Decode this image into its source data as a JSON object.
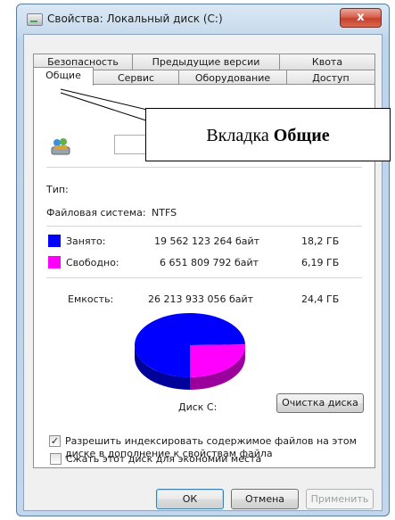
{
  "window": {
    "title": "Свойства: Локальный диск (C:)",
    "close_label": "x"
  },
  "tabs": {
    "row1": [
      "Безопасность",
      "Предыдущие версии",
      "Квота"
    ],
    "row2": [
      "Общие",
      "Сервис",
      "Оборудование",
      "Доступ"
    ],
    "active": "Общие"
  },
  "general": {
    "type_label": "Тип:",
    "fs_label": "Файловая система:",
    "fs_value": "NTFS",
    "used": {
      "label": "Занято:",
      "bytes": "19 562 123 264 байт",
      "size": "18,2 ГБ",
      "color": "#0000ff"
    },
    "free": {
      "label": "Свободно:",
      "bytes": "6 651 809 792 байт",
      "size": "6,19 ГБ",
      "color": "#ff00ff"
    },
    "capacity": {
      "label": "Емкость:",
      "bytes": "26 213 933 056 байт",
      "size": "24,4 ГБ"
    },
    "chart_caption": "Диск C:",
    "cleanup_button": "Очистка диска",
    "compress_label": "Сжать этот диск для экономии места",
    "compress_checked": false,
    "index_label_line1": "Разрешить индексировать содержимое файлов на этом",
    "index_label_line2": "диске в дополнение к свойствам файла",
    "index_checked": true
  },
  "buttons": {
    "ok": "ОК",
    "cancel": "Отмена",
    "apply": "Применить"
  },
  "callout": {
    "prefix": "Вкладка ",
    "bold": "Общие"
  },
  "chart_data": {
    "type": "pie",
    "categories": [
      "Занято",
      "Свободно"
    ],
    "values": [
      19562123264,
      6651809792
    ],
    "colors": [
      "#0000ff",
      "#ff00ff"
    ],
    "title": "Диск C:"
  }
}
